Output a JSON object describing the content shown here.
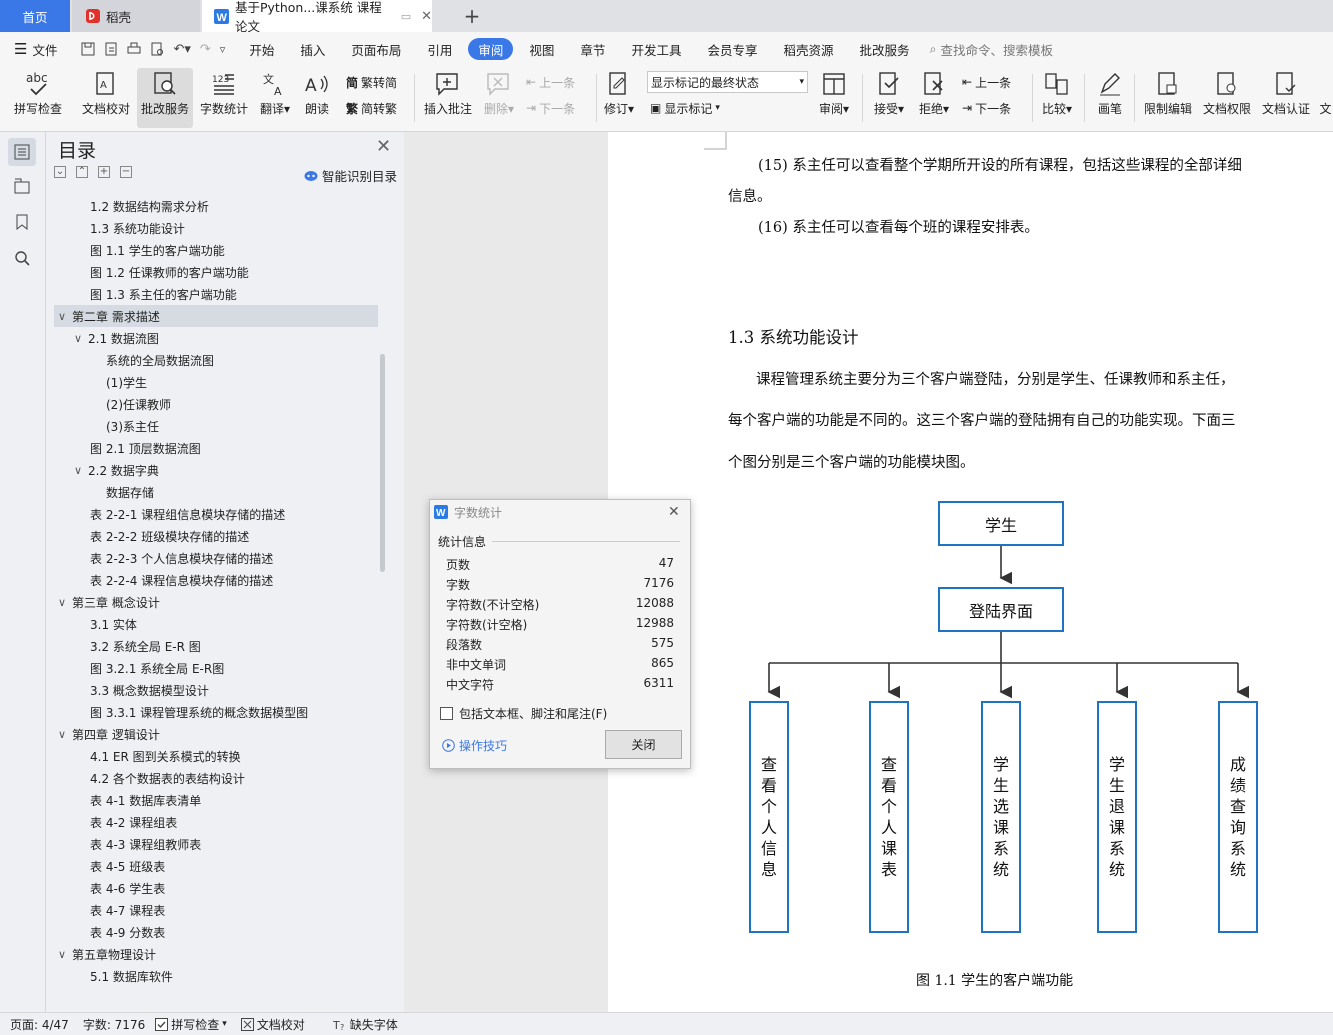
{
  "tabs": {
    "home": "首页",
    "daoke": "稻壳",
    "doc": "基于Python...课系统 课程论文",
    "add": "+"
  },
  "menubar": {
    "file": "文件",
    "items": [
      "开始",
      "插入",
      "页面布局",
      "引用",
      "审阅",
      "视图",
      "章节",
      "开发工具",
      "会员专享",
      "稻壳资源",
      "批改服务"
    ],
    "search_placeholder": "查找命令、搜索模板"
  },
  "ribbon": {
    "spell": "拼写检查",
    "doccheck": "文档校对",
    "correction": "批改服务",
    "wordcount": "字数统计",
    "translate": "翻译",
    "read": "朗读",
    "to_trad": "繁转简",
    "to_simp": "简转繁",
    "insert_comment": "插入批注",
    "delete": "删除",
    "prev": "上一条",
    "next": "下一条",
    "revise": "修订",
    "markup_state": "显示标记的最终状态",
    "show_markup": "显示标记",
    "review": "审阅",
    "accept": "接受",
    "reject": "拒绝",
    "prev2": "上一条",
    "next2": "下一条",
    "compare": "比较",
    "pen": "画笔",
    "restrict": "限制编辑",
    "permission": "文档权限",
    "certify": "文档认证",
    "cut": "文"
  },
  "toc": {
    "title": "目录",
    "smart": "智能识别目录",
    "items": [
      {
        "text": "1.2  数据结构需求分析",
        "level": 2,
        "caret": ""
      },
      {
        "text": "1.3 系统功能设计",
        "level": 2,
        "caret": ""
      },
      {
        "text": "图 1.1  学生的客户端功能",
        "level": 2,
        "caret": ""
      },
      {
        "text": "图 1.2  任课教师的客户端功能",
        "level": 2,
        "caret": ""
      },
      {
        "text": "图 1.3  系主任的客户端功能",
        "level": 2,
        "caret": ""
      },
      {
        "text": "第二章  需求描述",
        "level": 1,
        "caret": "∨"
      },
      {
        "text": "2.1  数据流图",
        "level": 2,
        "caret": "∨"
      },
      {
        "text": "系统的全局数据流图",
        "level": 3,
        "caret": ""
      },
      {
        "text": "(1)学生",
        "level": 3,
        "caret": ""
      },
      {
        "text": "(2)任课教师",
        "level": 3,
        "caret": ""
      },
      {
        "text": "(3)系主任",
        "level": 3,
        "caret": ""
      },
      {
        "text": "图 2.1  顶层数据流图",
        "level": 2,
        "caret": ""
      },
      {
        "text": "2.2  数据字典",
        "level": 2,
        "caret": "∨"
      },
      {
        "text": "数据存储",
        "level": 3,
        "caret": ""
      },
      {
        "text": "表 2-2-1  课程组信息模块存储的描述",
        "level": 2,
        "caret": ""
      },
      {
        "text": "表 2-2-2  班级模块存储的描述",
        "level": 2,
        "caret": ""
      },
      {
        "text": "表 2-2-3  个人信息模块存储的描述",
        "level": 2,
        "caret": ""
      },
      {
        "text": "表 2-2-4  课程信息模块存储的描述",
        "level": 2,
        "caret": ""
      },
      {
        "text": "第三章    概念设计",
        "level": 1,
        "caret": "∨"
      },
      {
        "text": "3.1  实体",
        "level": 2,
        "caret": ""
      },
      {
        "text": "3.2  系统全局 E-R 图",
        "level": 2,
        "caret": ""
      },
      {
        "text": "图 3.2.1  系统全局 E-R图",
        "level": 2,
        "caret": ""
      },
      {
        "text": "3.3  概念数据模型设计",
        "level": 2,
        "caret": ""
      },
      {
        "text": "图 3.3.1  课程管理系统的概念数据模型图",
        "level": 2,
        "caret": ""
      },
      {
        "text": "第四章  逻辑设计",
        "level": 1,
        "caret": "∨"
      },
      {
        "text": "4.1 ER 图到关系模式的转换",
        "level": 2,
        "caret": ""
      },
      {
        "text": "4.2    各个数据表的表结构设计",
        "level": 2,
        "caret": ""
      },
      {
        "text": "表 4-1  数据库表清单",
        "level": 2,
        "caret": ""
      },
      {
        "text": "表 4-2  课程组表",
        "level": 2,
        "caret": ""
      },
      {
        "text": "表 4-3  课程组教师表",
        "level": 2,
        "caret": ""
      },
      {
        "text": "表 4-5  班级表",
        "level": 2,
        "caret": ""
      },
      {
        "text": "表 4-6  学生表",
        "level": 2,
        "caret": ""
      },
      {
        "text": "表 4-7  课程表",
        "level": 2,
        "caret": ""
      },
      {
        "text": "表 4-9  分数表",
        "level": 2,
        "caret": ""
      },
      {
        "text": "第五章物理设计",
        "level": 1,
        "caret": "∨"
      },
      {
        "text": "5.1  数据库软件",
        "level": 2,
        "caret": ""
      }
    ]
  },
  "document": {
    "p15a": "(15) 系主任可以查看整个学期所开设的所有课程，包括这些课程的全部详细",
    "p15b": "信息。",
    "p16": "(16) 系主任可以查看每个班的课程安排表。",
    "heading": "1.3 系统功能设计",
    "body1": "课程管理系统主要分为三个客户端登陆，分别是学生、任课教师和系主任，",
    "body2": "每个客户端的功能是不同的。这三个客户端的登陆拥有自己的功能实现。下面三",
    "body3": "个图分别是三个客户端的功能模块图。",
    "flow": {
      "top": "学生",
      "login": "登陆界面",
      "modules": [
        "查看个人信息",
        "查看个人课表",
        "学生选课系统",
        "学生退课系统",
        "成绩查询系统"
      ]
    },
    "caption": "图 1.1  学生的客户端功能"
  },
  "dialog": {
    "title": "字数统计",
    "section": "统计信息",
    "stats": [
      {
        "label": "页数",
        "value": "47"
      },
      {
        "label": "字数",
        "value": "7176"
      },
      {
        "label": "字符数(不计空格)",
        "value": "12088"
      },
      {
        "label": "字符数(计空格)",
        "value": "12988"
      },
      {
        "label": "段落数",
        "value": "575"
      },
      {
        "label": "非中文单词",
        "value": "865"
      },
      {
        "label": "中文字符",
        "value": "6311"
      }
    ],
    "checkbox": "包括文本框、脚注和尾注(F)",
    "tips": "操作技巧",
    "close": "关闭"
  },
  "status": {
    "page": "页面: 4/47",
    "words": "字数: 7176",
    "spell": "拼写检查",
    "doccheck": "文档校对",
    "missing_font": "缺失字体"
  },
  "colors": {
    "accent": "#3b78e7",
    "flow_border": "#1f74c2"
  }
}
